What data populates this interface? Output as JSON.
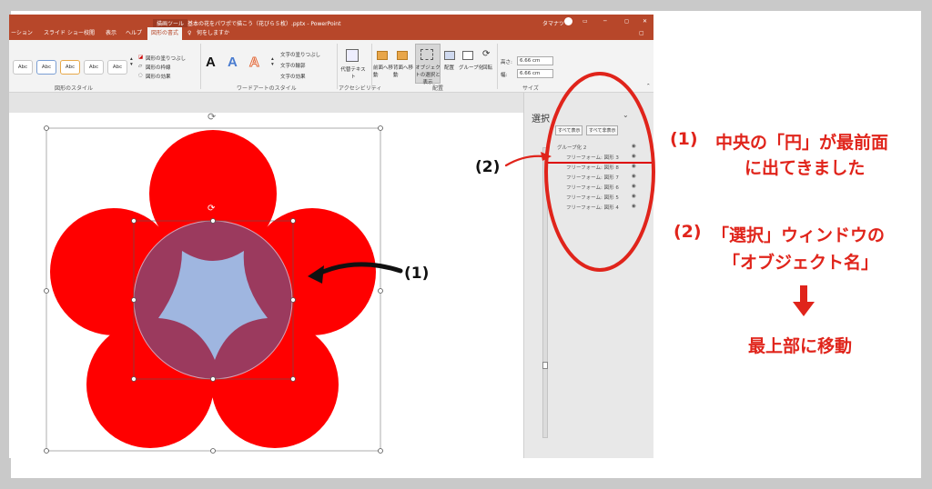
{
  "window": {
    "contextual_tab": "描画ツール",
    "title": "基本の花をパワポで描こう（花びら５枚）.pptx  -  PowerPoint",
    "user": "タマナツ"
  },
  "ribbon_tabs": [
    "ーション",
    "スライド ショー",
    "校閲",
    "表示",
    "ヘルプ",
    "図形の書式"
  ],
  "tell_me": "何をしますか",
  "ribbon": {
    "style_swatch_label": "Abc",
    "shape_fill": "図形の塗りつぶし",
    "shape_outline": "図形の枠線",
    "shape_effects": "図形の効果",
    "group_shape_styles": "図形のスタイル",
    "wordart_letter": "A",
    "text_fill": "文字の塗りつぶし",
    "text_outline": "文字の輪郭",
    "text_effects": "文字の効果",
    "group_wordart": "ワードアートのスタイル",
    "alt_text": "代替テキスト",
    "group_accessibility": "アクセシビリティ",
    "bring_forward": "前面へ移動",
    "send_backward": "背面へ移動",
    "selection_pane": "オブジェクトの選択と表示",
    "align": "配置",
    "group": "グループ化",
    "rotate": "回転",
    "group_arrange": "配置",
    "height_label": "高さ:",
    "height_value": "6.66 cm",
    "width_label": "幅:",
    "width_value": "6.66 cm",
    "group_size": "サイズ"
  },
  "selection_pane": {
    "title": "選択",
    "show_all": "すべて表示",
    "hide_all": "すべて非表示",
    "group_name": "グループ化 2",
    "items": [
      "フリーフォーム: 図形 3",
      "フリーフォーム: 図形 8",
      "フリーフォーム: 図形 7",
      "フリーフォーム: 図形 6",
      "フリーフォーム: 図形 5",
      "フリーフォーム: 図形 4"
    ]
  },
  "annotations": {
    "label1": "(1)",
    "label2": "(2)",
    "note1_num": "(1)",
    "note1_line1": "中央の「円」が最前面",
    "note1_line2": "に出てきました",
    "note2_num": "(2)",
    "note2_line1": "「選択」ウィンドウの",
    "note2_line2": "「オブジェクト名」",
    "note2_result": "最上部に移動"
  },
  "colors": {
    "petal": "#ff0000",
    "center_circle": "#9b3a5e",
    "star": "#9fb6e0",
    "annotation": "#e0241b",
    "ppt_accent": "#b7472a"
  }
}
